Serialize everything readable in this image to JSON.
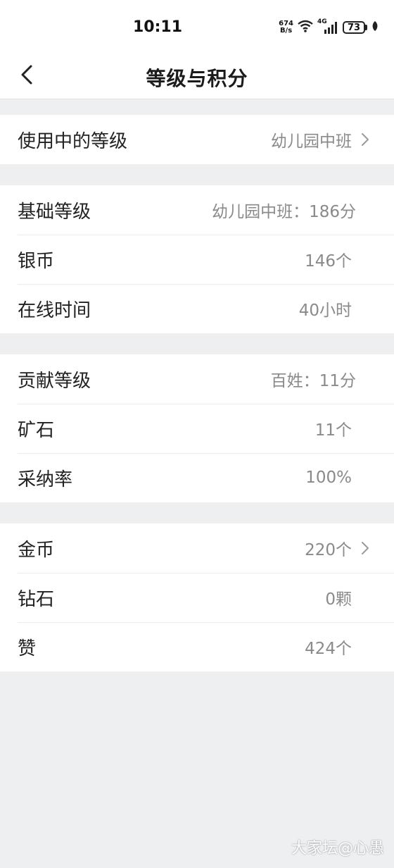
{
  "status_bar": {
    "time": "10:11",
    "net_speed_value": "674",
    "net_speed_unit": "B/s",
    "network": "4G",
    "battery": "73",
    "icons": [
      "wifi-icon",
      "signal-icon",
      "battery-icon",
      "leaf-icon"
    ]
  },
  "header": {
    "title": "等级与积分",
    "back_icon": "chevron-left-icon"
  },
  "sections": {
    "current": {
      "label": "使用中的等级",
      "value": "幼儿园中班"
    },
    "basic": {
      "level_label": "基础等级",
      "level_value": "幼儿园中班：186分",
      "silver_label": "银币",
      "silver_value": "146个",
      "online_label": "在线时间",
      "online_value": "40小时"
    },
    "contribution": {
      "level_label": "贡献等级",
      "level_value": "百姓：11分",
      "ore_label": "矿石",
      "ore_value": "11个",
      "accept_label": "采纳率",
      "accept_value": "100%"
    },
    "assets": {
      "gold_label": "金币",
      "gold_value": "220个",
      "diamond_label": "钻石",
      "diamond_value": "0颗",
      "like_label": "赞",
      "like_value": "424个"
    }
  },
  "watermark": "大家坛@心愚"
}
